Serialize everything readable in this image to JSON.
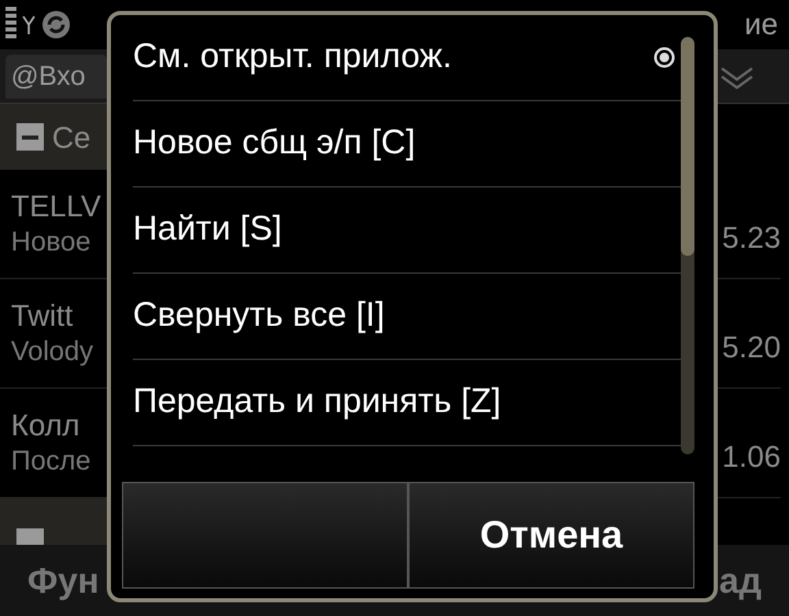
{
  "status_bar": {
    "title": "ие"
  },
  "tab": {
    "label": "@Вхо"
  },
  "section": {
    "label": "Се",
    "expanded": true
  },
  "messages": [
    {
      "sender": "TELLV",
      "preview": "Новое",
      "time": "5.23"
    },
    {
      "sender": "Twitt",
      "preview": "Volody",
      "time": "5.20"
    },
    {
      "sender": "Колл",
      "preview": "После",
      "time": "1.06"
    }
  ],
  "softkeys": {
    "left": "Фун",
    "right": "ад"
  },
  "menu": {
    "items": [
      {
        "label": "См. открыт. прилож.",
        "kind": "submenu"
      },
      {
        "label": "Новое сбщ э/п [C]",
        "kind": "command"
      },
      {
        "label": "Найти [S]",
        "kind": "command"
      },
      {
        "label": "Свернуть все [I]",
        "kind": "command"
      },
      {
        "label": "Передать и принять [Z]",
        "kind": "command"
      }
    ],
    "cancel_button": "Отмена"
  }
}
